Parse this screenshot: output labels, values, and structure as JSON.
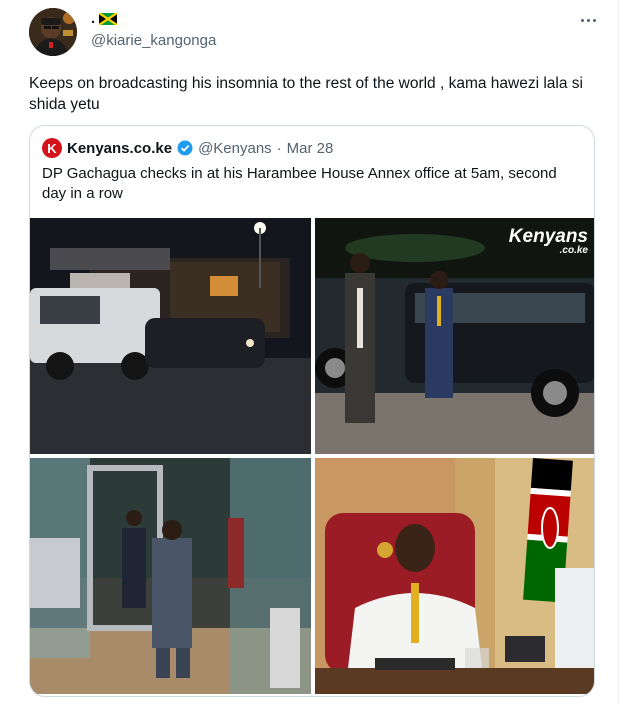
{
  "tweet": {
    "display_name": ".",
    "flag_icon": "jamaica-flag-icon",
    "handle": "@kiarie_kangonga",
    "text": "Keeps on broadcasting his insomnia to the rest of the world , kama hawezi lala si shida yetu",
    "more_icon": "more-options-icon"
  },
  "quote": {
    "logo_letter": "K",
    "name": "Kenyans.co.ke",
    "verified_icon": "verified-badge-icon",
    "handle": "@Kenyans",
    "separator": "·",
    "date": "Mar 28",
    "text": "DP Gachagua checks in at his Harambee House Annex office at 5am, second day in a row",
    "watermark_main": "Kenyans",
    "watermark_sub": ".co.ke"
  },
  "colors": {
    "brand_red": "#d4141c",
    "verified_blue": "#1d9bf0",
    "jamaica_green": "#009b3a",
    "jamaica_gold": "#fed100"
  }
}
